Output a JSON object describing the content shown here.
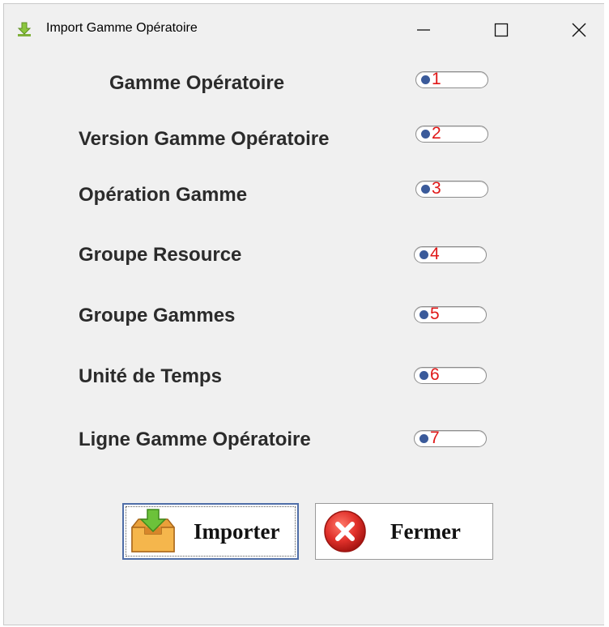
{
  "window": {
    "title": "Import Gamme Opératoire",
    "icon": "download-arrow-icon",
    "controls": [
      "minimize-icon",
      "maximize-icon",
      "close-icon"
    ]
  },
  "rows": [
    {
      "label": "Gamme Opératoire",
      "value": "1"
    },
    {
      "label": "Version Gamme Opératoire",
      "value": "2"
    },
    {
      "label": "Opération Gamme",
      "value": "3"
    },
    {
      "label": "Groupe Resource",
      "value": "4"
    },
    {
      "label": "Groupe Gammes",
      "value": "5"
    },
    {
      "label": "Unité de Temps",
      "value": "6"
    },
    {
      "label": "Ligne Gamme Opératoire",
      "value": "7"
    }
  ],
  "buttons": {
    "import_label": "Importer",
    "import_icon": "import-tray-icon",
    "close_label": "Fermer",
    "close_icon": "red-cancel-icon"
  },
  "colors": {
    "window_bg": "#f0f0f0",
    "label_text": "#2b2b2b",
    "field_value": "#e01818",
    "field_dot": "#3a5a9a",
    "import_border": "#4f6ea8"
  }
}
